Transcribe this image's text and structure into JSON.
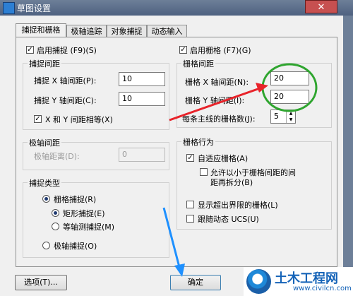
{
  "window": {
    "title": "草图设置",
    "close_glyph": "✕"
  },
  "tabs": [
    {
      "label": "捕捉和栅格",
      "active": true
    },
    {
      "label": "极轴追踪"
    },
    {
      "label": "对象捕捉"
    },
    {
      "label": "动态输入"
    }
  ],
  "snap": {
    "enable_label": "启用捕捉 (F9)(S)",
    "spacing_group": "捕捉间距",
    "x_label": "捕捉 X 轴间距(P):",
    "x_value": "10",
    "y_label": "捕捉 Y 轴间距(C):",
    "y_value": "10",
    "equal_label": "X 和 Y 间距相等(X)"
  },
  "polar": {
    "group": "极轴间距",
    "distance_label": "极轴距离(D):",
    "distance_value": "0"
  },
  "snap_type": {
    "group": "捕捉类型",
    "grid_snap": "栅格捕捉(R)",
    "rect_snap": "矩形捕捉(E)",
    "iso_snap": "等轴测捕捉(M)",
    "polar_snap": "极轴捕捉(O)"
  },
  "grid": {
    "enable_label": "启用栅格 (F7)(G)",
    "spacing_group": "栅格间距",
    "x_label": "栅格 X 轴间距(N):",
    "x_value": "20",
    "y_label": "栅格 Y 轴间距(I):",
    "y_value": "20",
    "major_label": "每条主线的栅格数(J):",
    "major_value": "5"
  },
  "grid_behavior": {
    "group": "栅格行为",
    "adaptive": "自适应栅格(A)",
    "subdivide_line1": "允许以小于栅格间距的间",
    "subdivide_line2": "距再拆分(B)",
    "beyond": "显示超出界限的栅格(L)",
    "follow_ucs": "跟随动态 UCS(U)"
  },
  "buttons": {
    "options": "选项(T)...",
    "ok": "确定"
  },
  "watermark": {
    "title": "土木工程网",
    "url": "www.civilcn.com"
  },
  "colors": {
    "annotation_green": "#2fa52f",
    "arrow_red": "#e8232a",
    "arrow_blue": "#1e90ff"
  }
}
